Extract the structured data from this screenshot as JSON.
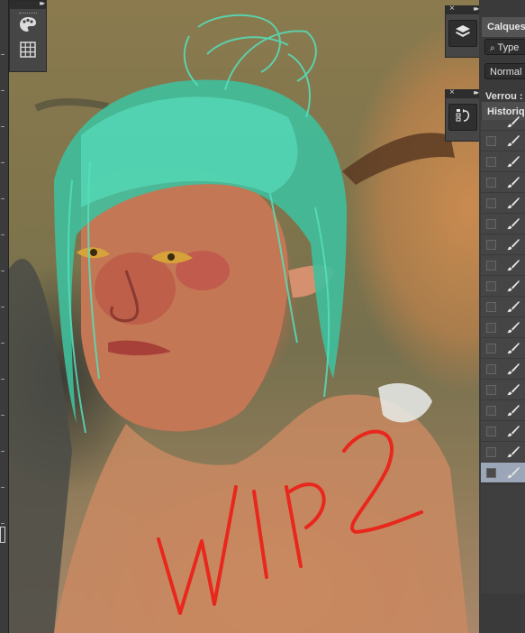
{
  "panels": {
    "layers": {
      "title": "Calques",
      "search_label": "Type",
      "blend_mode": "Normal",
      "lock_label": "Verrou :"
    },
    "history": {
      "title": "Historiq",
      "row_count": 18
    }
  },
  "canvas_text": "WIP2",
  "icons": [
    "palette-icon",
    "grid-icon",
    "layers-icon",
    "history-icon",
    "brush-icon",
    "search-icon",
    "close-icon",
    "collapse-arrows-icon"
  ],
  "colors": {
    "hair": "#46d9b4",
    "text_overlay": "#e8271d",
    "panel": "#3a3a3a",
    "active_row": "#9ba6b8"
  }
}
